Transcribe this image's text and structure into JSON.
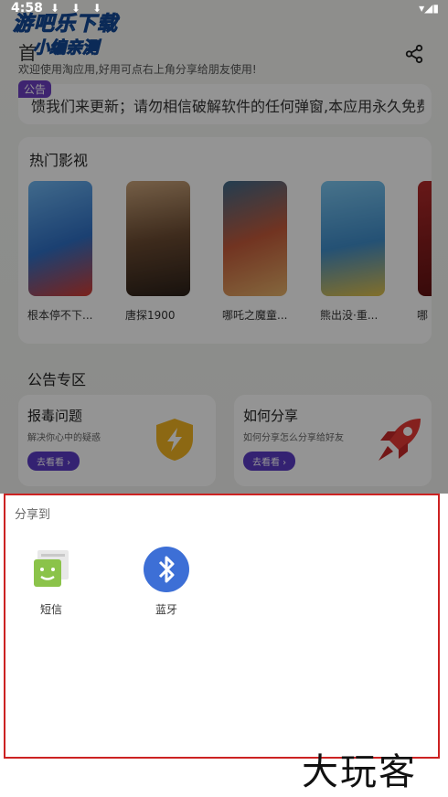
{
  "status_bar": {
    "time": "4:58"
  },
  "watermark": {
    "line1": "游吧乐下载",
    "line2": "小编亲测"
  },
  "header": {
    "title_partial": "首",
    "welcome": "欢迎使用淘应用,好用可点右上角分享给朋友使用!"
  },
  "notice": {
    "badge": "公告",
    "text": "馈我们来更新；请勿相信破解软件的任何弹窗,本应用永久免费"
  },
  "hot": {
    "title": "热门影视",
    "movies": [
      {
        "name": "根本停不下...",
        "color": "#3b7fd6"
      },
      {
        "name": "唐探1900",
        "color": "#7a5a3a"
      },
      {
        "name": "哪吒之魔童...",
        "color": "#c2533a"
      },
      {
        "name": "熊出没·重...",
        "color": "#4aa0d8"
      },
      {
        "name": "哪",
        "color": "#8a1f1f"
      }
    ]
  },
  "announcements": {
    "title": "公告专区",
    "cards": [
      {
        "title": "报毒问题",
        "desc": "解决你心中的疑惑",
        "button": "去看看",
        "icon": "shield-lightning-icon"
      },
      {
        "title": "如何分享",
        "desc": "如何分享怎么分享给好友",
        "button": "去看看",
        "icon": "rocket-icon"
      }
    ]
  },
  "share_sheet": {
    "title": "分享到",
    "apps": [
      {
        "label": "短信",
        "icon": "sms-icon",
        "color": "#8bc34a"
      },
      {
        "label": "蓝牙",
        "icon": "bluetooth-icon",
        "color": "#3d6fd6"
      }
    ]
  },
  "brand": {
    "text": "大玩客"
  }
}
